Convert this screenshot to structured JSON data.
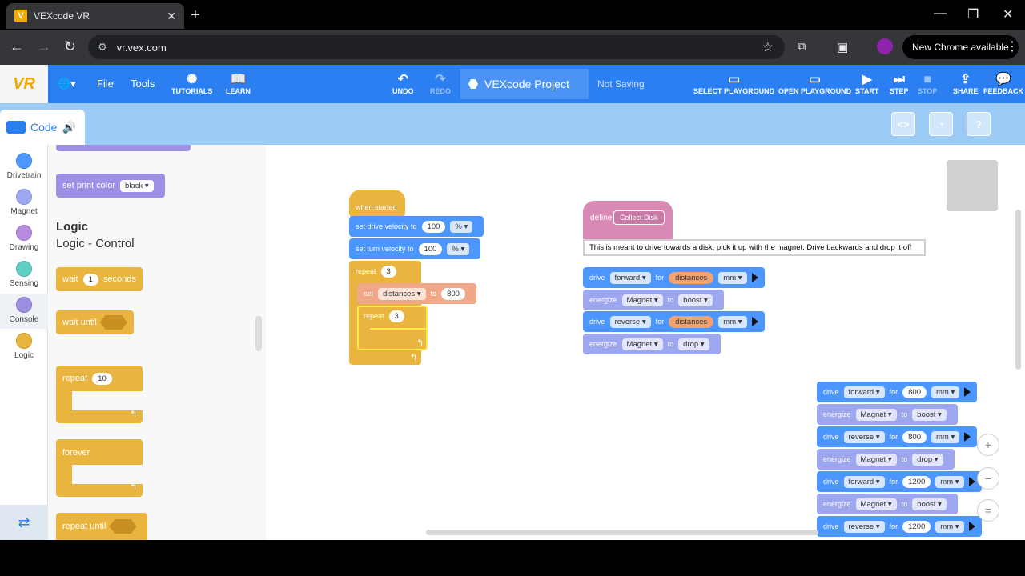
{
  "browser": {
    "tab_title": "VEXcode VR",
    "url": "vr.vex.com",
    "new_chrome": "New Chrome available"
  },
  "header": {
    "logo": "VR",
    "file": "File",
    "tools": "Tools",
    "tutorials": "TUTORIALS",
    "learn": "LEARN",
    "undo": "UNDO",
    "redo": "REDO",
    "project_name": "VEXcode Project",
    "save_status": "Not Saving",
    "select_playground": "SELECT PLAYGROUND",
    "open_playground": "OPEN PLAYGROUND",
    "start": "START",
    "step": "STEP",
    "stop": "STOP",
    "share": "SHARE",
    "feedback": "FEEDBACK"
  },
  "subbar": {
    "code_tab": "Code",
    "code_toggle": "<>"
  },
  "categories": [
    "Drivetrain",
    "Magnet",
    "Drawing",
    "Sensing",
    "Console",
    "Logic"
  ],
  "category_colors": [
    "#4c97ff",
    "#9da7f0",
    "#b78be0",
    "#5fcfc6",
    "#9c8fe0",
    "#e9b53f"
  ],
  "flyout": {
    "print_color": {
      "label": "set print color",
      "value": "black"
    },
    "logic_title": "Logic",
    "logic_subtitle": "Logic - Control",
    "wait": {
      "label": "wait",
      "value": "1",
      "unit": "seconds"
    },
    "wait_until": "wait until",
    "repeat": {
      "label": "repeat",
      "value": "10"
    },
    "forever": "forever",
    "repeat_until": "repeat until"
  },
  "main_script": {
    "hat": "when started",
    "drive_velocity": {
      "label": "set drive velocity to",
      "value": "100",
      "unit": "%"
    },
    "turn_velocity": {
      "label": "set turn velocity to",
      "value": "100",
      "unit": "%"
    },
    "repeat_outer": {
      "label": "repeat",
      "value": "3"
    },
    "set_var": {
      "label": "set",
      "var": "distances",
      "to": "to",
      "value": "800"
    },
    "repeat_inner": {
      "label": "repeat",
      "value": "3"
    }
  },
  "define_script": {
    "define": "define",
    "name": "Collect Disk",
    "comment": "This is meant to drive towards a disk, pick it up with the magnet. Drive backwards and drop it off",
    "b1": {
      "label": "drive",
      "dir": "forward",
      "for": "for",
      "var": "distances",
      "unit": "mm"
    },
    "b2": {
      "label": "energize",
      "target": "Magnet",
      "to": "to",
      "mode": "boost"
    },
    "b3": {
      "label": "drive",
      "dir": "reverse",
      "for": "for",
      "var": "distances",
      "unit": "mm"
    },
    "b4": {
      "label": "energize",
      "target": "Magnet",
      "to": "to",
      "mode": "drop"
    }
  },
  "loose_script": {
    "b1": {
      "label": "drive",
      "dir": "forward",
      "for": "for",
      "value": "800",
      "unit": "mm"
    },
    "b2": {
      "label": "energize",
      "target": "Magnet",
      "to": "to",
      "mode": "boost"
    },
    "b3": {
      "label": "drive",
      "dir": "reverse",
      "for": "for",
      "value": "800",
      "unit": "mm"
    },
    "b4": {
      "label": "energize",
      "target": "Magnet",
      "to": "to",
      "mode": "drop"
    },
    "b5": {
      "label": "drive",
      "dir": "forward",
      "for": "for",
      "value": "1200",
      "unit": "mm"
    },
    "b6": {
      "label": "energize",
      "target": "Magnet",
      "to": "to",
      "mode": "boost"
    },
    "b7": {
      "label": "drive",
      "dir": "reverse",
      "for": "for",
      "value": "1200",
      "unit": "mm"
    }
  },
  "zoom": {
    "in": "+",
    "out": "−",
    "reset": "="
  }
}
